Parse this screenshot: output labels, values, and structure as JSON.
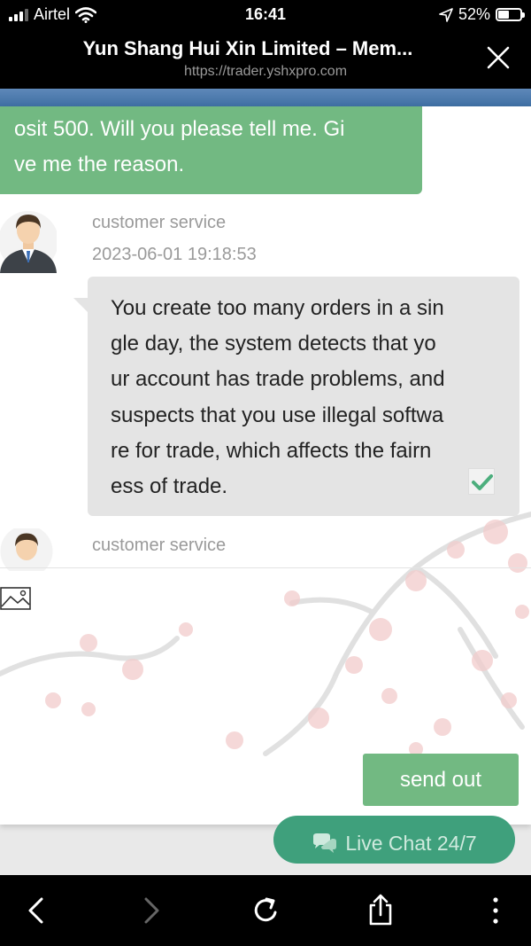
{
  "status_bar": {
    "carrier": "Airtel",
    "time": "16:41",
    "battery": "52%"
  },
  "browser": {
    "title": "Yun Shang Hui Xin Limited – Mem...",
    "url": "https://trader.yshxpro.com"
  },
  "chat": {
    "outgoing_message": {
      "lines": [
        "osit 500. Will you please tell me. Gi",
        "ve me the reason."
      ]
    },
    "messages": [
      {
        "sender": "customer service",
        "timestamp": "2023-06-01 19:18:53",
        "lines": [
          "You create too many orders in a sin",
          "gle day, the system detects that yo",
          "ur account has trade problems, and",
          "suspects that you use illegal softwa",
          "re for trade, which affects the fairn",
          "ess of trade."
        ]
      },
      {
        "sender": "customer service"
      }
    ],
    "send_label": "send out",
    "live_chat_label": "Live Chat 24/7"
  },
  "colors": {
    "bubble_green": "#72b982",
    "incoming_bubble": "#e4e4e4",
    "live_chat_green": "#3fa07c"
  },
  "icons": [
    "wifi-icon",
    "location-arrow-icon",
    "close-icon",
    "avatar-icon",
    "checkmark-icon",
    "image-icon",
    "chat-bubbles-icon",
    "back-icon",
    "forward-icon",
    "reload-icon",
    "share-icon",
    "more-icon"
  ]
}
